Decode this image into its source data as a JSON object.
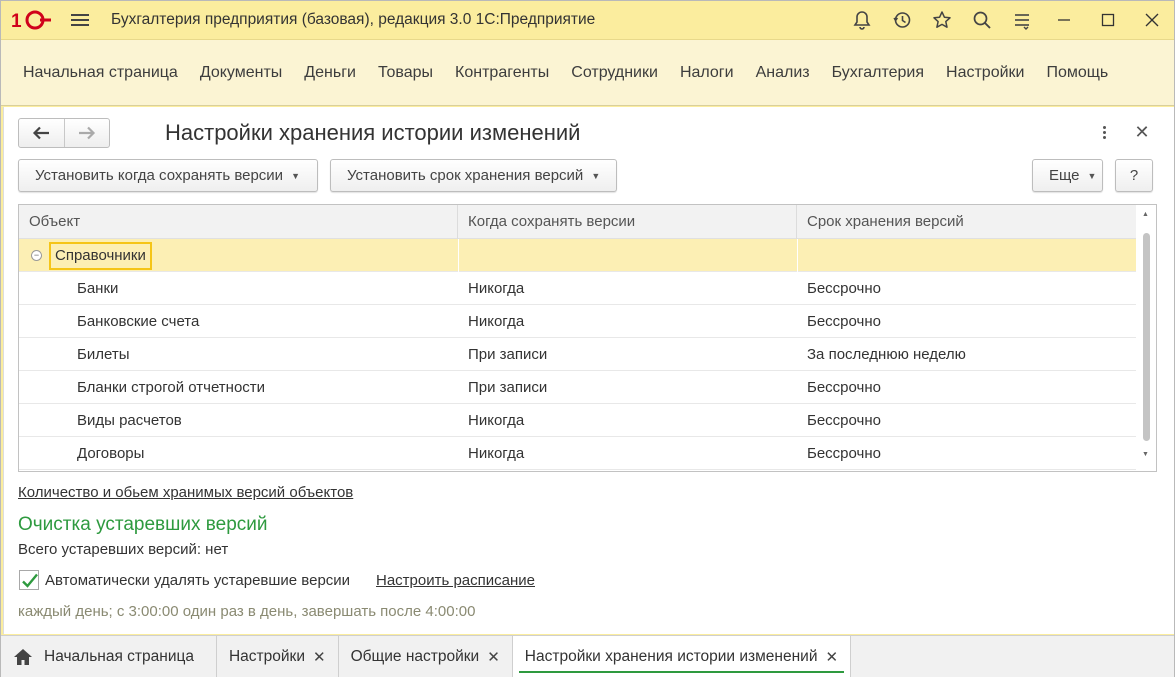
{
  "titlebar": {
    "app_title": "Бухгалтерия предприятия (базовая), редакция 3.0 1С:Предприятие",
    "icons": [
      "bell-icon",
      "history-icon",
      "star-icon",
      "search-icon",
      "settings-icon",
      "minimize-icon",
      "maximize-icon",
      "close-icon"
    ]
  },
  "main_menu": {
    "items": [
      "Начальная страница",
      "Документы",
      "Деньги",
      "Товары",
      "Контрагенты",
      "Сотрудники",
      "Налоги",
      "Анализ",
      "Бухгалтерия",
      "Настройки",
      "Помощь"
    ]
  },
  "form": {
    "title": "Настройки хранения истории изменений",
    "buttons": {
      "when_save": "Установить когда сохранять версии",
      "retention": "Установить срок хранения версий",
      "more": "Еще",
      "help": "?"
    },
    "table": {
      "columns": [
        "Объект",
        "Когда сохранять версии",
        "Срок хранения версий"
      ],
      "group": "Справочники",
      "rows": [
        {
          "object": "Банки",
          "when": "Никогда",
          "period": "Бессрочно"
        },
        {
          "object": "Банковские счета",
          "when": "Никогда",
          "period": "Бессрочно"
        },
        {
          "object": "Билеты",
          "when": "При записи",
          "period": "За последнюю неделю"
        },
        {
          "object": "Бланки строгой отчетности",
          "when": "При записи",
          "period": "Бессрочно"
        },
        {
          "object": "Виды расчетов",
          "when": "Никогда",
          "period": "Бессрочно"
        },
        {
          "object": "Договоры",
          "when": "Никогда",
          "period": "Бессрочно"
        }
      ]
    },
    "versions_link": "Количество и обьем хранимых версий объектов",
    "cleanup": {
      "title": "Очистка устаревших версий",
      "total": "Всего устаревших версий: нет",
      "auto_delete_label": "Автоматически удалять устаревшие версии",
      "auto_delete_checked": true,
      "schedule_link": "Настроить расписание",
      "schedule_text": "каждый день; с 3:00:00 один раз в день, завершать после 4:00:00"
    }
  },
  "tabs": [
    {
      "label": "Начальная страница",
      "closable": false
    },
    {
      "label": "Настройки",
      "closable": true
    },
    {
      "label": "Общие настройки",
      "closable": true
    },
    {
      "label": "Настройки хранения истории изменений",
      "closable": true,
      "active": true
    }
  ],
  "colors": {
    "titlebar_bg": "#fbed9e",
    "menu_bg": "#fbf4d3",
    "group_row_bg": "#fcefb4",
    "section_green": "#2e9a3f",
    "link_blue": "#1e50a0",
    "logo_red": "#d0021b"
  }
}
